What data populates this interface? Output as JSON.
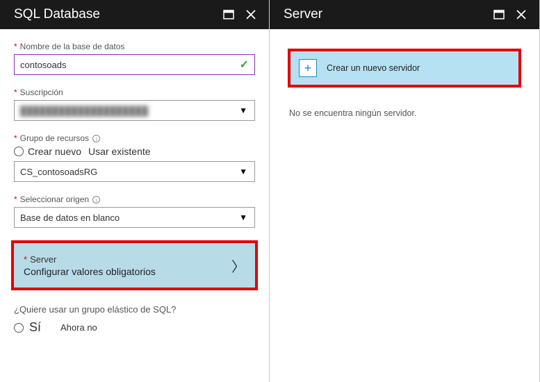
{
  "left": {
    "title": "SQL Database",
    "db_name": {
      "label": "Nombre de la base de datos",
      "value": "contosoads"
    },
    "subscription": {
      "label": "Suscripción",
      "value": "████████████████████"
    },
    "resource_group": {
      "label": "Grupo de recursos",
      "create_new": "Crear nuevo",
      "use_existing": "Usar existente",
      "value": "CS_contosoadsRG"
    },
    "source": {
      "label": "Seleccionar origen",
      "value": "Base de datos en blanco"
    },
    "server": {
      "label": "Server",
      "value": "Configurar valores obligatorios"
    },
    "elastic": {
      "question": "¿Quiere usar un grupo elástico de SQL?",
      "yes": "Sí",
      "no": "Ahora no"
    }
  },
  "right": {
    "title": "Server",
    "create_tile": "Crear un nuevo servidor",
    "empty_msg": "No se encuentra ningún servidor."
  }
}
